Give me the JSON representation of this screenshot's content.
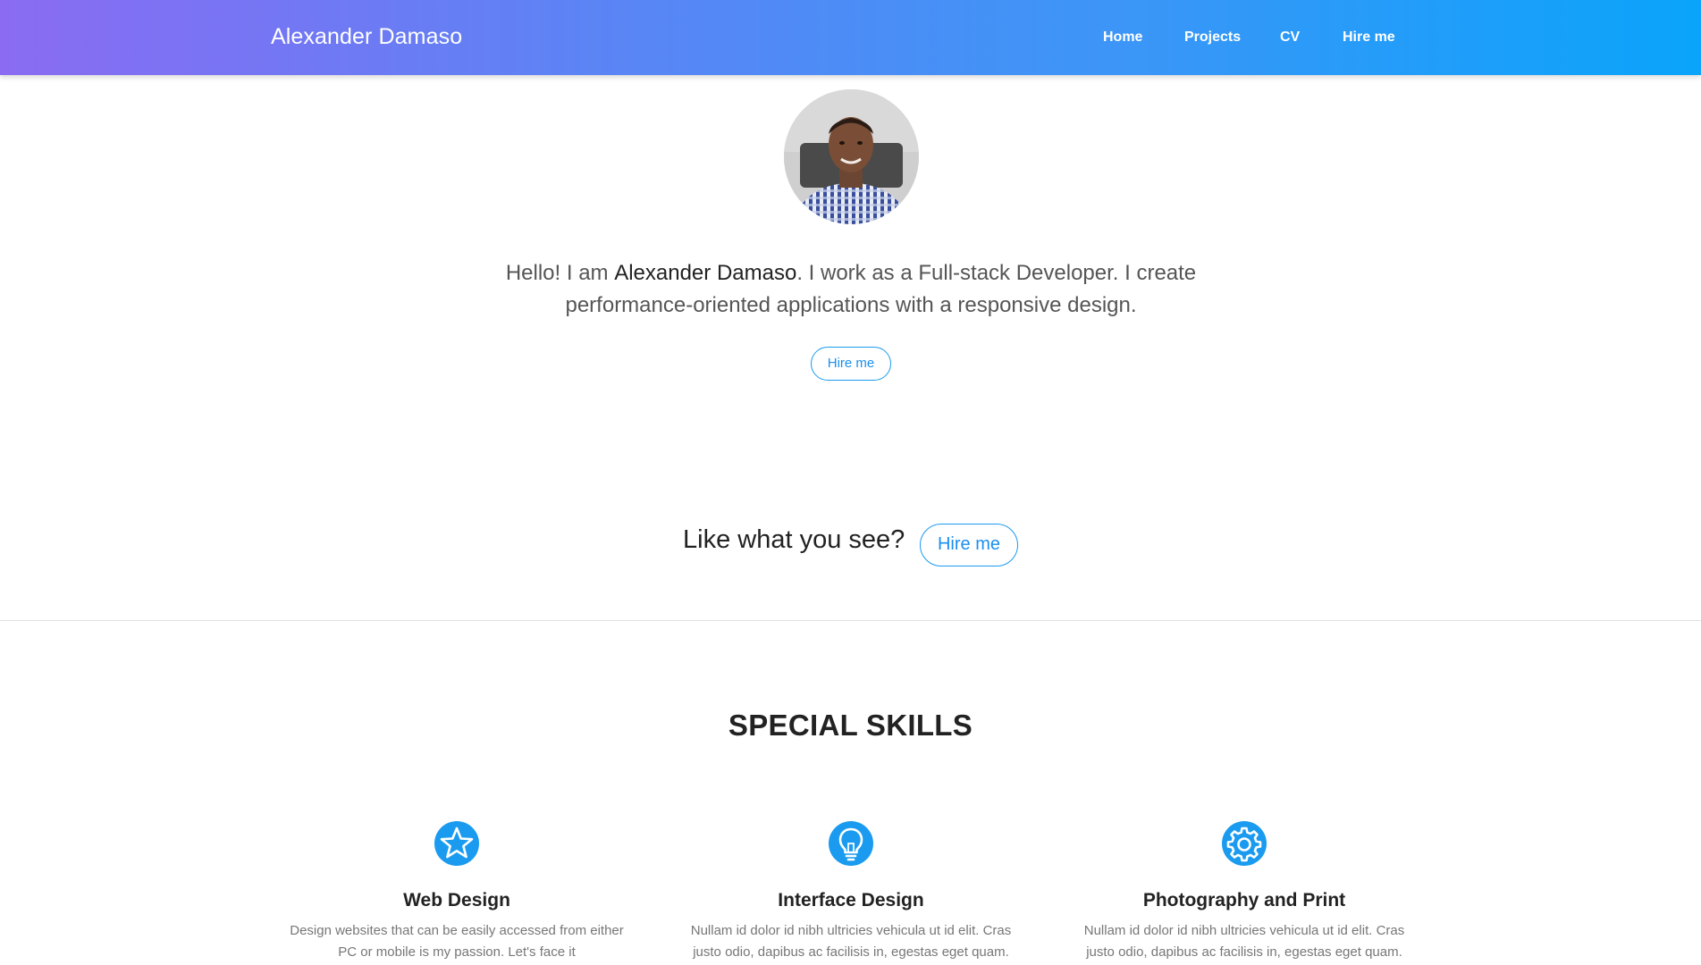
{
  "navbar": {
    "brand": "Alexander Damaso",
    "links": [
      "Home",
      "Projects",
      "CV",
      "Hire me"
    ],
    "gradient_start": "#8a6bf2",
    "gradient_end": "#0aa4fb"
  },
  "hero": {
    "avatar_alt": "Profile photo",
    "intro_prefix": "Hello! I am ",
    "intro_name": "Alexander Damaso",
    "intro_suffix": ". I work as a Full-stack Developer. I create performance-oriented applications with a responsive design.",
    "button_label": "Hire me"
  },
  "cta": {
    "text": "Like what you see?",
    "button_label": "Hire me"
  },
  "skills": {
    "title": "SPECIAL SKILLS",
    "items": [
      {
        "icon": "star-icon",
        "title": "Web Design",
        "description": "Design websites that can be easily accessed from either PC or mobile is my passion. Let's face it"
      },
      {
        "icon": "lightbulb-icon",
        "title": "Interface Design",
        "description": "Nullam id dolor id nibh ultricies vehicula ut id elit. Cras justo odio, dapibus ac facilisis in, egestas eget quam."
      },
      {
        "icon": "gear-icon",
        "title": "Photography and Print",
        "description": "Nullam id dolor id nibh ultricies vehicula ut id elit. Cras justo odio, dapibus ac facilisis in, egestas eget quam."
      }
    ]
  },
  "colors": {
    "accent": "#1a9bf0",
    "text_dark": "#222222",
    "text_muted": "#777777"
  }
}
